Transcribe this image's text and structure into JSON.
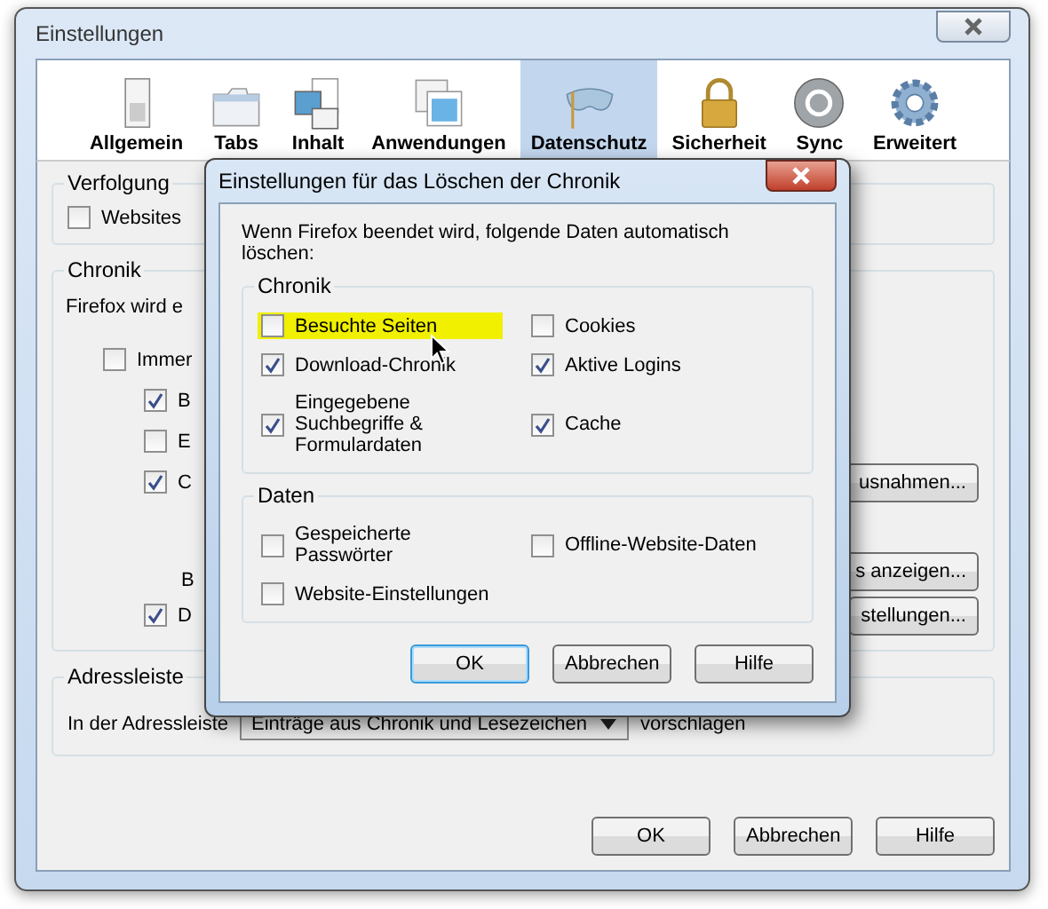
{
  "window": {
    "title": "Einstellungen"
  },
  "toolbar": [
    {
      "label": "Allgemein",
      "selected": false
    },
    {
      "label": "Tabs",
      "selected": false
    },
    {
      "label": "Inhalt",
      "selected": false
    },
    {
      "label": "Anwendungen",
      "selected": false
    },
    {
      "label": "Datenschutz",
      "selected": true
    },
    {
      "label": "Sicherheit",
      "selected": false
    },
    {
      "label": "Sync",
      "selected": false
    },
    {
      "label": "Erweitert",
      "selected": false
    }
  ],
  "tracking": {
    "legend": "Verfolgung",
    "checkbox": {
      "label": "Websites",
      "checked": false
    }
  },
  "history": {
    "legend": "Chronik",
    "intro": "Firefox wird e",
    "rows": [
      {
        "label": "Immer",
        "checked": false,
        "children": [
          {
            "kind": "check",
            "label": "B",
            "checked": true
          },
          {
            "kind": "check",
            "label": "E",
            "checked": false
          },
          {
            "kind": "check",
            "label": "C",
            "checked": true,
            "button": "usnahmen..."
          },
          {
            "kind": "text",
            "label": "B",
            "button": "s anzeigen..."
          },
          {
            "kind": "check",
            "label": "D",
            "checked": true,
            "button": "stellungen..."
          }
        ]
      }
    ]
  },
  "address": {
    "legend": "Adressleiste",
    "label": "In der Adressleiste",
    "dropdown": "Einträge aus Chronik und Lesezeichen",
    "after": "vorschlagen"
  },
  "buttons": [
    {
      "label": "OK"
    },
    {
      "label": "Abbrechen"
    },
    {
      "label": "Hilfe"
    }
  ],
  "dialog": {
    "title": "Einstellungen für das Löschen der Chronik",
    "intro": "Wenn Firefox beendet wird, folgende Daten automatisch löschen:",
    "groups": [
      {
        "legend": "Chronik",
        "items": [
          {
            "label": "Besuchte Seiten",
            "checked": false,
            "highlighted": true
          },
          {
            "label": "Cookies",
            "checked": false,
            "highlighted": false
          },
          {
            "label": "Download-Chronik",
            "checked": true,
            "highlighted": false
          },
          {
            "label": "Aktive Logins",
            "checked": true,
            "highlighted": false
          },
          {
            "label": "Eingegebene Suchbegriffe & Formulardaten",
            "checked": true,
            "highlighted": false
          },
          {
            "label": "Cache",
            "checked": true,
            "highlighted": false
          }
        ]
      },
      {
        "legend": "Daten",
        "items": [
          {
            "label": "Gespeicherte Passwörter",
            "checked": false,
            "highlighted": false
          },
          {
            "label": "Offline-Website-Daten",
            "checked": false,
            "highlighted": false
          },
          {
            "label": "Website-Einstellungen",
            "checked": false,
            "highlighted": false
          }
        ]
      }
    ],
    "buttons": [
      {
        "label": "OK",
        "default": true
      },
      {
        "label": "Abbrechen",
        "default": false
      },
      {
        "label": "Hilfe",
        "default": false
      }
    ]
  }
}
